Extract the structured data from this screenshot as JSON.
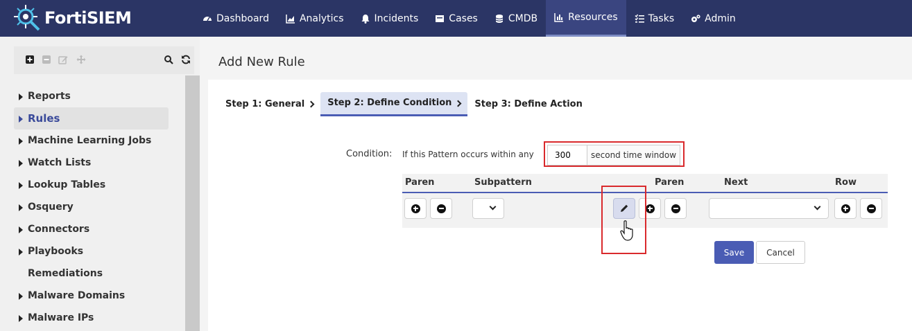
{
  "app": {
    "name": "FortiSIEM",
    "accent": "#2b3565",
    "primary_button": "#4a5cb4",
    "highlight_color": "#d9292c"
  },
  "nav": {
    "items": [
      {
        "label": "Dashboard",
        "icon": "dashboard-icon"
      },
      {
        "label": "Analytics",
        "icon": "chart-icon"
      },
      {
        "label": "Incidents",
        "icon": "bell-icon"
      },
      {
        "label": "Cases",
        "icon": "folder-icon"
      },
      {
        "label": "CMDB",
        "icon": "database-icon"
      },
      {
        "label": "Resources",
        "icon": "bar-chart-icon",
        "active": true
      },
      {
        "label": "Tasks",
        "icon": "tasks-icon"
      },
      {
        "label": "Admin",
        "icon": "gears-icon"
      }
    ]
  },
  "sidebar": {
    "toolbar_icons": [
      "add-icon",
      "remove-icon",
      "edit-icon",
      "move-icon",
      "search-icon",
      "refresh-icon"
    ],
    "items": [
      {
        "label": "Reports",
        "caret": true
      },
      {
        "label": "Rules",
        "caret": true,
        "active": true
      },
      {
        "label": "Machine Learning Jobs",
        "caret": true
      },
      {
        "label": "Watch Lists",
        "caret": true
      },
      {
        "label": "Lookup Tables",
        "caret": true
      },
      {
        "label": "Osquery",
        "caret": true
      },
      {
        "label": "Connectors",
        "caret": true
      },
      {
        "label": "Playbooks",
        "caret": true
      },
      {
        "label": "Remediations",
        "caret": false
      },
      {
        "label": "Malware Domains",
        "caret": true
      },
      {
        "label": "Malware IPs",
        "caret": true
      }
    ]
  },
  "main": {
    "title": "Add New Rule",
    "steps": [
      {
        "label": "Step 1: General",
        "chevron": true
      },
      {
        "label": "Step 2: Define Condition",
        "chevron": true,
        "active": true
      },
      {
        "label": "Step 3: Define Action",
        "chevron": false
      }
    ],
    "condition": {
      "label": "Condition:",
      "prefix": "If this Pattern occurs within any",
      "window_value": "300",
      "suffix": "second time window"
    },
    "grid": {
      "headers": {
        "paren_left": "Paren",
        "subpattern": "Subpattern",
        "paren_right": "Paren",
        "next": "Next",
        "row": "Row"
      }
    },
    "buttons": {
      "save": "Save",
      "cancel": "Cancel"
    }
  }
}
